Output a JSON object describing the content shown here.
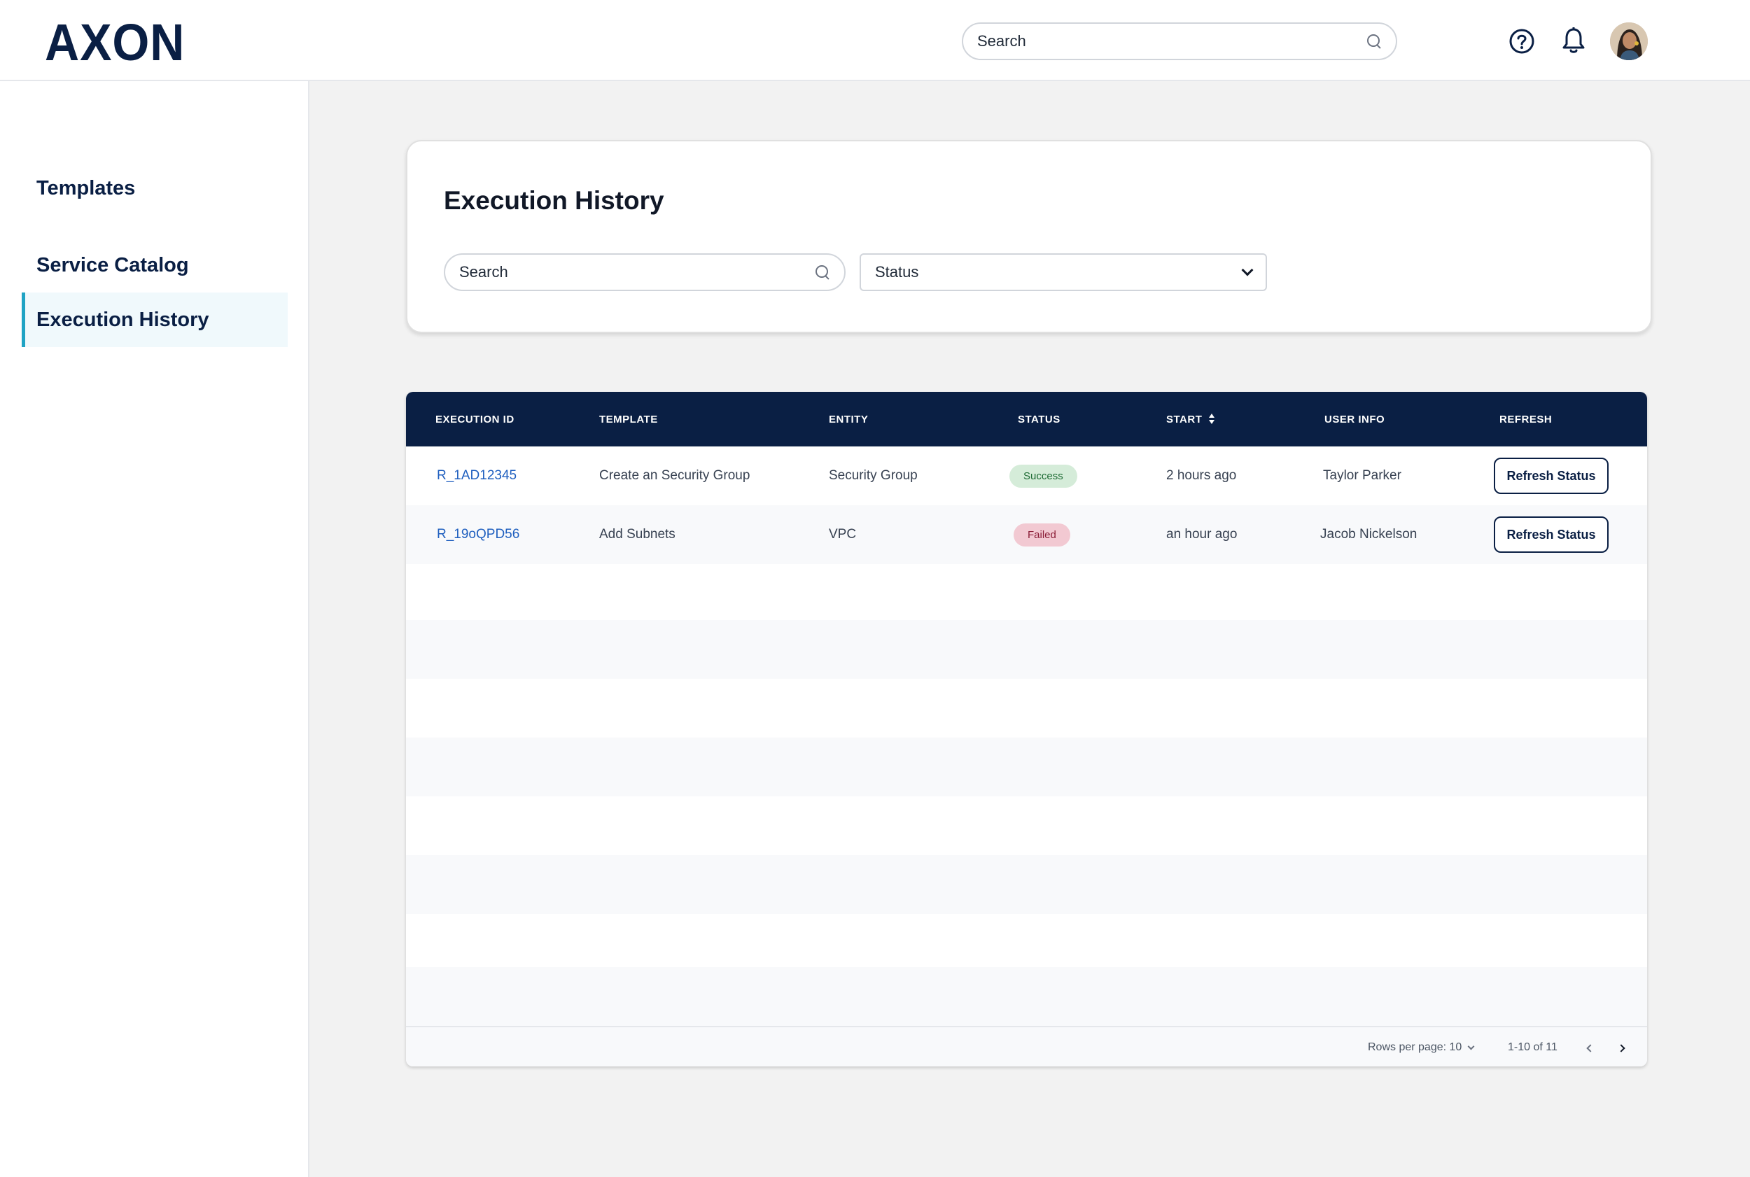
{
  "app": {
    "logo": "AXON"
  },
  "header": {
    "search_placeholder": "Search"
  },
  "sidebar": {
    "items": [
      {
        "label": "Templates",
        "active": false
      },
      {
        "label": "Service Catalog",
        "active": false
      },
      {
        "label": "Execution History",
        "active": true
      }
    ]
  },
  "filters": {
    "title": "Execution History",
    "search_placeholder": "Search",
    "status_value": "Status"
  },
  "table": {
    "columns": [
      "EXECUTION ID",
      "TEMPLATE",
      "ENTITY",
      "STATUS",
      "START",
      "USER INFO",
      "REFRESH"
    ],
    "rows": [
      {
        "id": "R_1AD12345",
        "template": "Create an Security Group",
        "entity": "Security Group",
        "status": "Success",
        "start": "2 hours ago",
        "user": "Taylor Parker",
        "action": "Refresh Status"
      },
      {
        "id": "R_19oQPD56",
        "template": "Add Subnets",
        "entity": "VPC",
        "status": "Failed",
        "start": "an hour ago",
        "user": "Jacob Nickelson",
        "action": "Refresh Status"
      }
    ],
    "pagination": {
      "rows_per_page": "Rows per page: 10",
      "range": "1-10 of 11"
    }
  },
  "colors": {
    "brand_navy": "#0a1f44",
    "accent_teal": "#1fa3c4",
    "link_blue": "#1f5fbf",
    "success_bg": "#d5ecd9",
    "failed_bg": "#f2c9d2"
  },
  "icons": [
    "search-icon",
    "help-circle-icon",
    "bell-icon",
    "sort-icon",
    "chevron-down-icon",
    "chevron-left-icon",
    "chevron-right-icon"
  ]
}
